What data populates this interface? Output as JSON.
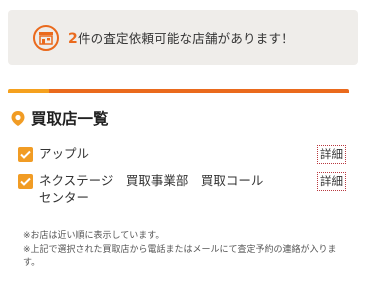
{
  "banner": {
    "icon": "shop-icon",
    "count": "2",
    "text": "件の査定依頼可能な店舗があります！"
  },
  "colors": {
    "accent": "#ea6a1d",
    "accent_light": "#f5a11e",
    "checkbox": "#f19c24",
    "banner_bg": "#efedea"
  },
  "section": {
    "icon": "location-pin-icon",
    "title": "買取店一覧"
  },
  "shops": [
    {
      "name": "アップル",
      "detail_label": "詳細",
      "checked": true
    },
    {
      "name": "ネクステージ　買取事業部　買取コールセンター",
      "detail_label": "詳細",
      "checked": true
    }
  ],
  "notes": [
    "※お店は近い順に表示しています。",
    "※上記で選択された買取店から電話またはメールにて査定予約の連絡が入ります。"
  ]
}
